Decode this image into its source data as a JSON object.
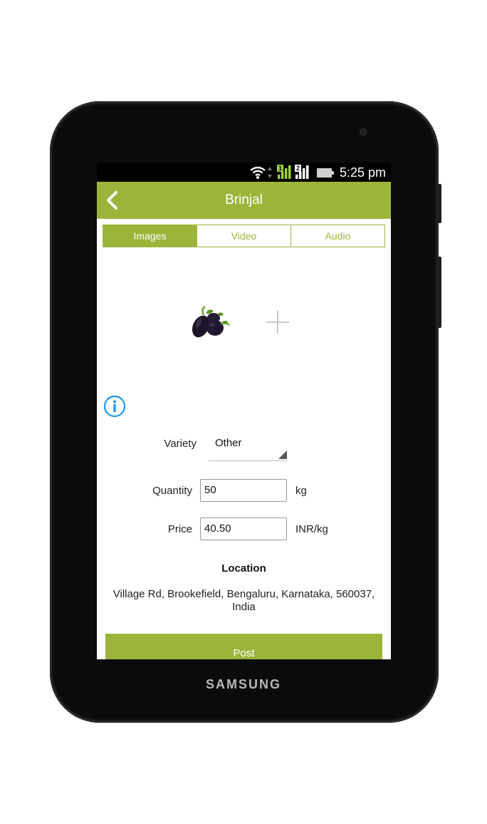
{
  "device": {
    "brand": "SAMSUNG"
  },
  "status_bar": {
    "time": "5:25 pm",
    "sim1": "1",
    "sim2": "2"
  },
  "app_bar": {
    "title": "Brinjal"
  },
  "tabs": [
    {
      "label": "Images",
      "active": true
    },
    {
      "label": "Video",
      "active": false
    },
    {
      "label": "Audio",
      "active": false
    }
  ],
  "media": {
    "thumbnail": "brinjal-image",
    "add_icon": "plus-icon"
  },
  "form": {
    "variety": {
      "label": "Variety",
      "value": "Other"
    },
    "quantity": {
      "label": "Quantity",
      "value": "50",
      "unit": "kg"
    },
    "price": {
      "label": "Price",
      "value": "40.50",
      "unit": "INR/kg"
    }
  },
  "location": {
    "title": "Location",
    "address": "Village Rd, Brookefield, Bengaluru, Karnataka, 560037, India"
  },
  "actions": {
    "post_label": "Post"
  },
  "colors": {
    "accent": "#9bb53b",
    "info_blue": "#2196f3"
  }
}
